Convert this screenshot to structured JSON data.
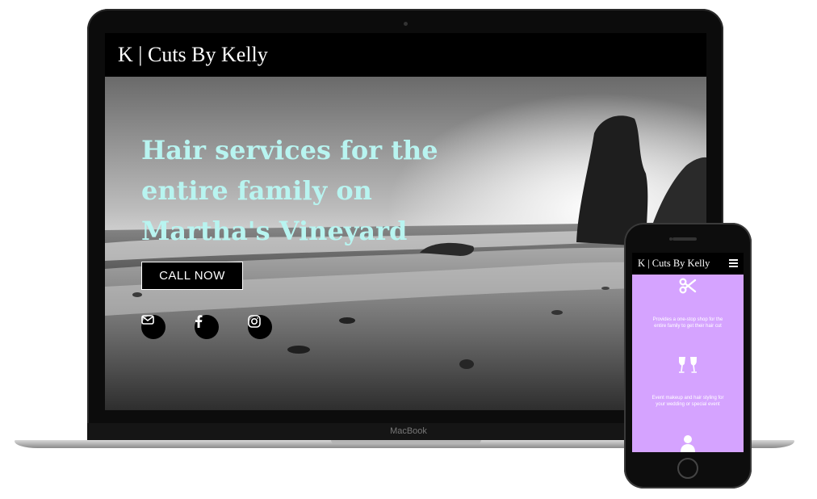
{
  "device": {
    "laptop_label": "MacBook"
  },
  "site": {
    "logo": "K | Cuts By Kelly",
    "headline": "Hair services for the entire family on Martha's Vineyard",
    "cta_label": "CALL NOW",
    "social": [
      {
        "icon": "envelope-icon"
      },
      {
        "icon": "facebook-icon"
      },
      {
        "icon": "instagram-icon"
      }
    ],
    "colors": {
      "headline": "#b8f4f0",
      "mobile_background": "#d5a3ff"
    }
  },
  "mobile": {
    "logo": "K | Cuts By Kelly",
    "menu_icon": "hamburger-menu-icon",
    "services": [
      {
        "icon": "scissors-icon",
        "text": "Provides a one-stop shop for the entire family to get their hair cut"
      },
      {
        "icon": "champagne-glasses-icon",
        "text": "Event makeup and hair styling for your wedding or special event"
      },
      {
        "icon": "person-icon",
        "text": ""
      }
    ]
  }
}
